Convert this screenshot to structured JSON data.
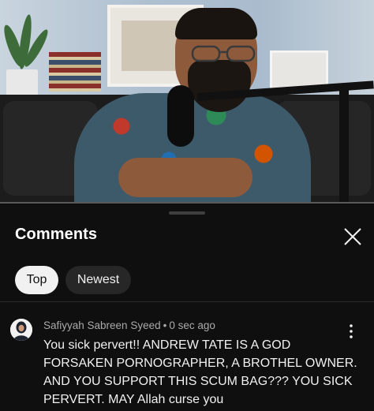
{
  "panel": {
    "title": "Comments",
    "close_icon": "close-icon"
  },
  "sort_chips": [
    {
      "label": "Top",
      "selected": true
    },
    {
      "label": "Newest",
      "selected": false
    }
  ],
  "comments": [
    {
      "author": "Safiyyah Sabreen Syeed",
      "separator": "•",
      "timestamp": "0 sec ago",
      "text_lines": [
        "You sick pervert!! ANDREW TATE IS A GOD",
        "FORSAKEN PORNOGRAPHER, A BROTHEL OWNER.",
        "AND YOU SUPPORT THIS SCUM BAG??? YOU SICK",
        "PERVERT. MAY Allah curse you"
      ],
      "menu_icon": "more-vertical-icon"
    }
  ],
  "colors": {
    "background": "#0f0f0f",
    "chip_selected_bg": "#f1f1f1",
    "chip_bg": "#272727",
    "secondary_text": "#aaaaaa"
  }
}
